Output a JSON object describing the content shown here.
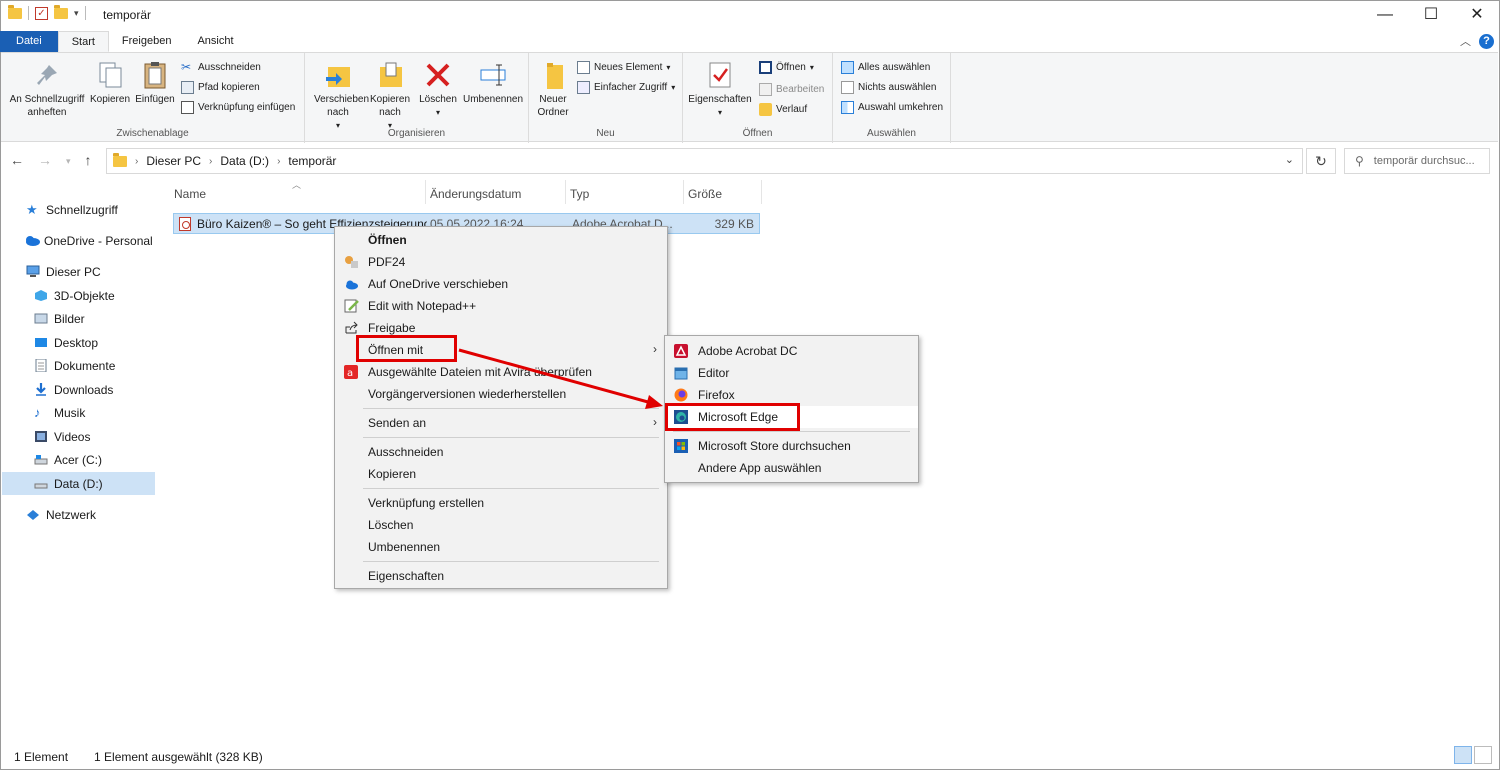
{
  "window": {
    "title": "temporär",
    "buttons": {
      "minimize": "—",
      "maximize": "☐",
      "close": "✕"
    }
  },
  "ribbon_tabs": [
    "Datei",
    "Start",
    "Freigeben",
    "Ansicht"
  ],
  "ribbon": {
    "clipboard": {
      "label": "Zwischenablage",
      "pin": "An Schnellzugriff anheften",
      "copy": "Kopieren",
      "paste": "Einfügen",
      "cut": "Ausschneiden",
      "copy_path": "Pfad kopieren",
      "paste_shortcut": "Verknüpfung einfügen"
    },
    "organize": {
      "label": "Organisieren",
      "move_to": "Verschieben nach",
      "copy_to": "Kopieren nach",
      "delete": "Löschen",
      "rename": "Umbenennen"
    },
    "new": {
      "label": "Neu",
      "new_folder": "Neuer Ordner",
      "new_item": "Neues Element",
      "easy_access": "Einfacher Zugriff"
    },
    "open": {
      "label": "Öffnen",
      "properties": "Eigenschaften",
      "open": "Öffnen",
      "edit": "Bearbeiten",
      "history": "Verlauf"
    },
    "select": {
      "label": "Auswählen",
      "select_all": "Alles auswählen",
      "select_none": "Nichts auswählen",
      "invert": "Auswahl umkehren"
    }
  },
  "address": {
    "crumbs": [
      "Dieser PC",
      "Data (D:)",
      "temporär"
    ],
    "search_placeholder": "temporär durchsuc..."
  },
  "sidebar": [
    {
      "label": "Schnellzugriff",
      "icon": "star-icon"
    },
    {
      "label": "OneDrive - Personal",
      "icon": "cloud-icon"
    },
    {
      "label": "Dieser PC",
      "icon": "computer-icon"
    },
    {
      "label": "3D-Objekte",
      "icon": "cube-icon"
    },
    {
      "label": "Bilder",
      "icon": "pictures-icon"
    },
    {
      "label": "Desktop",
      "icon": "desktop-icon"
    },
    {
      "label": "Dokumente",
      "icon": "documents-icon"
    },
    {
      "label": "Downloads",
      "icon": "download-icon"
    },
    {
      "label": "Musik",
      "icon": "music-icon"
    },
    {
      "label": "Videos",
      "icon": "video-icon"
    },
    {
      "label": "Acer (C:)",
      "icon": "drive-icon"
    },
    {
      "label": "Data (D:)",
      "icon": "drive-icon"
    },
    {
      "label": "Netzwerk",
      "icon": "network-icon"
    }
  ],
  "columns": [
    "Name",
    "Änderungsdatum",
    "Typ",
    "Größe"
  ],
  "file": {
    "name": "Büro Kaizen® – So geht Effizienzsteigerung",
    "date": "05.05.2022 16:24",
    "type": "Adobe Acrobat D...",
    "size": "329 KB"
  },
  "context_menu": [
    "Öffnen",
    "PDF24",
    "Auf OneDrive verschieben",
    "Edit with Notepad++",
    "Freigabe",
    "Öffnen mit",
    "Ausgewählte Dateien mit Avira überprüfen",
    "Vorgängerversionen wiederherstellen",
    "Senden an",
    "Ausschneiden",
    "Kopieren",
    "Verknüpfung erstellen",
    "Löschen",
    "Umbenennen",
    "Eigenschaften"
  ],
  "open_with_menu": [
    "Adobe Acrobat DC",
    "Editor",
    "Firefox",
    "Microsoft Edge",
    "Microsoft Store durchsuchen",
    "Andere App auswählen"
  ],
  "status": {
    "count": "1 Element",
    "selected": "1 Element ausgewählt (328 KB)"
  },
  "colors": {
    "accent": "#1a5fb4",
    "selection": "#cde2f6",
    "highlight_box": "#e00000"
  }
}
